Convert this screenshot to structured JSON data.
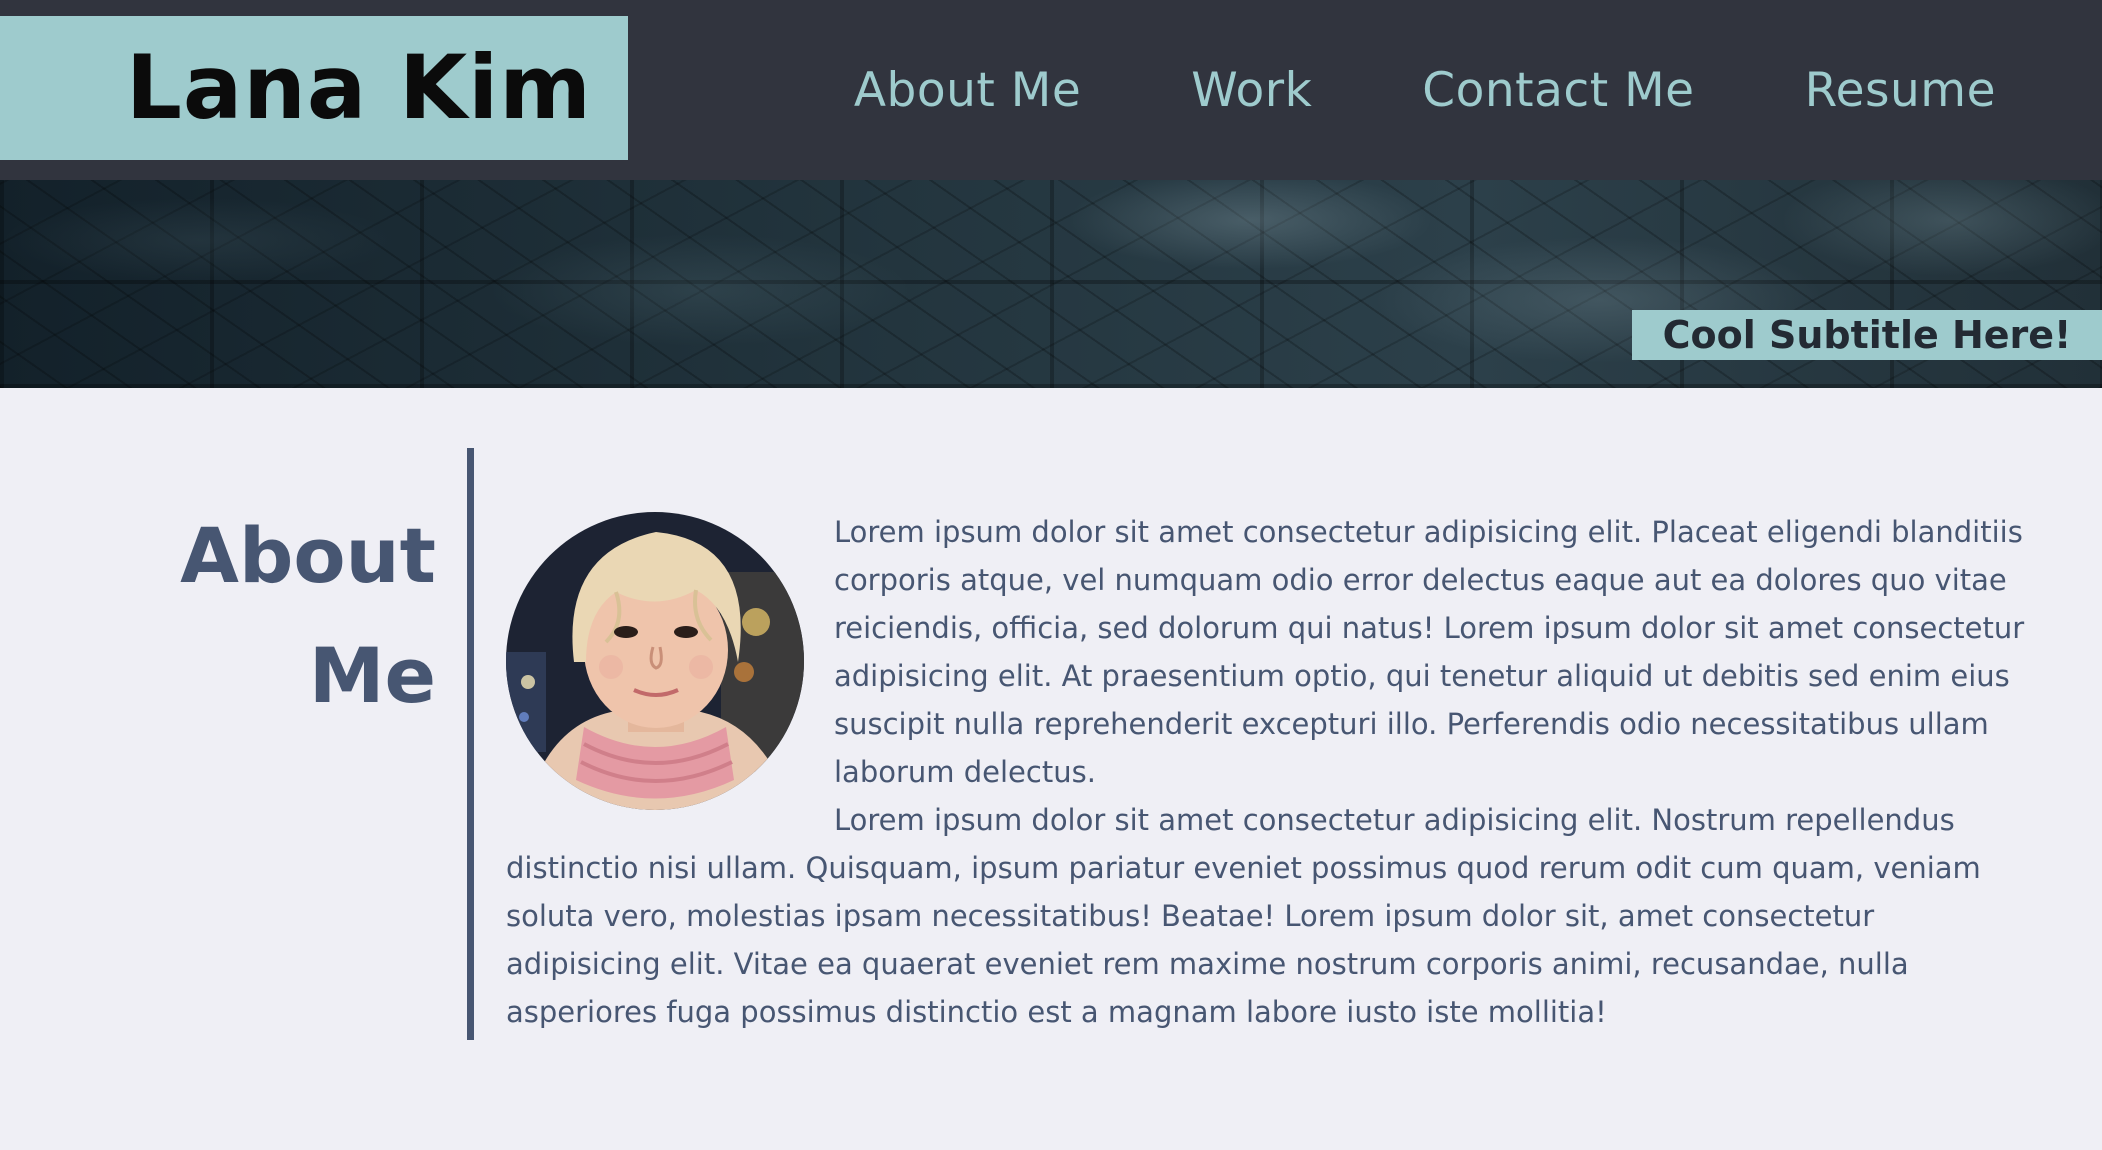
{
  "header": {
    "brand_title": "Lana Kim",
    "nav": [
      {
        "label": "About Me"
      },
      {
        "label": "Work"
      },
      {
        "label": "Contact Me"
      },
      {
        "label": "Resume"
      }
    ]
  },
  "hero": {
    "subtitle": "Cool Subtitle Here!"
  },
  "about": {
    "heading": "About Me",
    "paragraphs": [
      "Lorem ipsum dolor sit amet consectetur adipisicing elit. Placeat eligendi blanditiis corporis atque, vel numquam odio error delectus eaque aut ea dolores quo vitae reiciendis, officia, sed dolorum qui natus! Lorem ipsum dolor sit amet consectetur adipisicing elit. At praesentium optio, qui tenetur aliquid ut debitis sed enim eius suscipit nulla reprehenderit excepturi illo. Perferendis odio necessitatibus ullam laborum delectus.",
      "Lorem ipsum dolor sit amet consectetur adipisicing elit. Nostrum repellendus distinctio nisi ullam. Quisquam, ipsum pariatur eveniet possimus quod rerum odit cum quam, veniam soluta vero, molestias ipsam necessitatibus! Beatae! Lorem ipsum dolor sit, amet consectetur adipisicing elit. Vitae ea quaerat eveniet rem maxime nostrum corporis animi, recusandae, nulla asperiores fuga possimus distinctio est a magnam labore iusto iste mollitia!"
    ]
  },
  "colors": {
    "header_bg": "#31343e",
    "accent": "#9ecbcd",
    "page_bg": "#efeff5",
    "text": "#475672"
  }
}
